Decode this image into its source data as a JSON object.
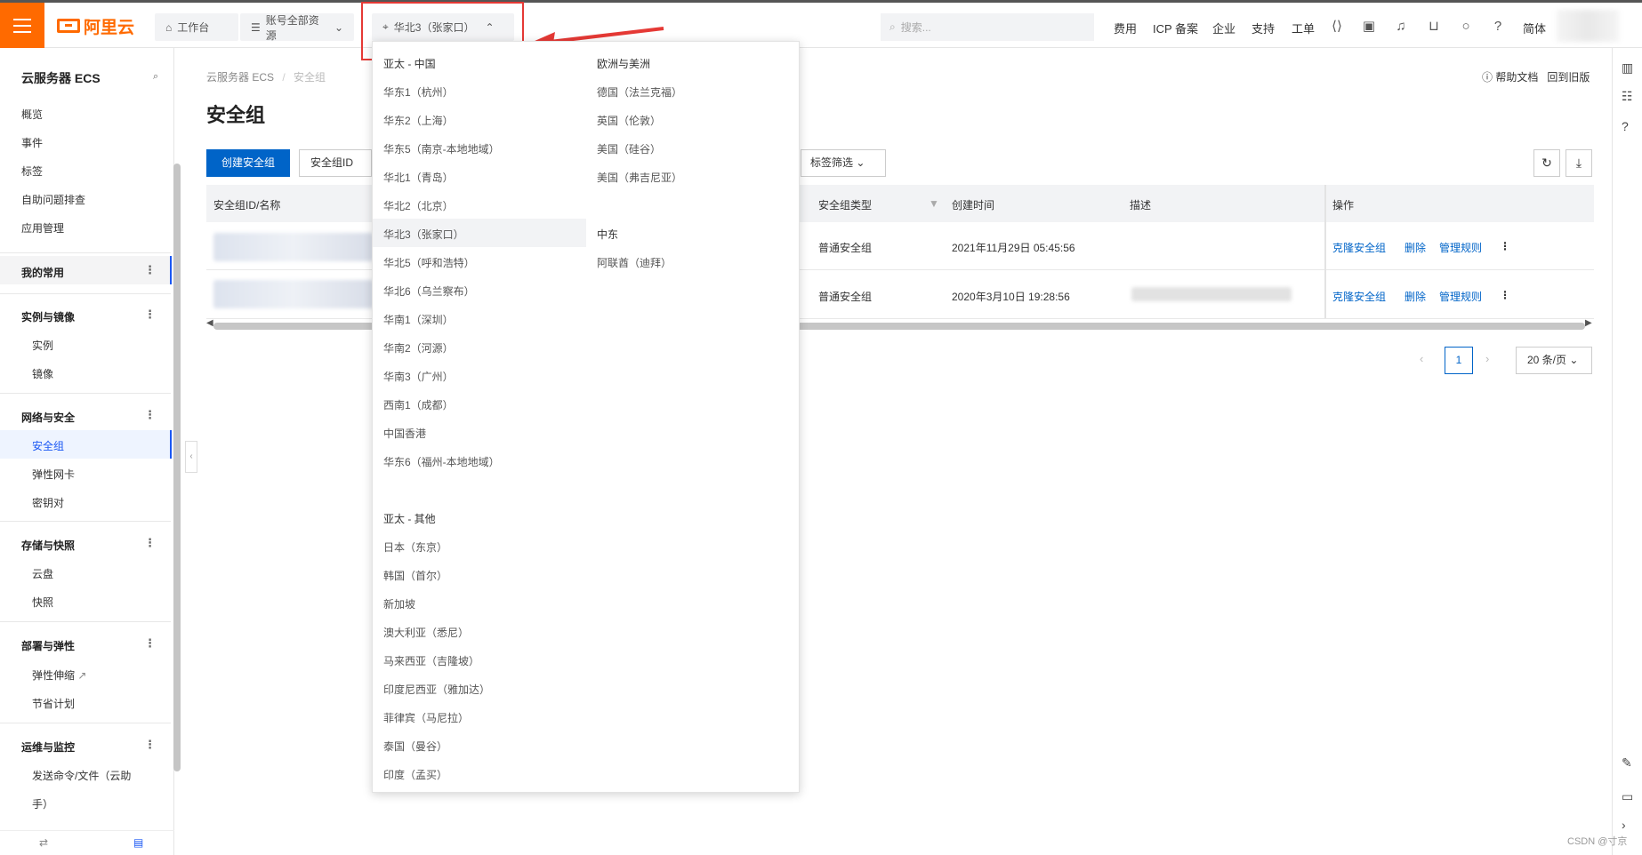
{
  "topbar": {
    "logo_text": "阿里云",
    "workbench": "工作台",
    "resources": "账号全部资源",
    "region": "华北3（张家口）",
    "search_placeholder": "搜索...",
    "nav": [
      "费用",
      "ICP 备案",
      "企业",
      "支持",
      "工单"
    ],
    "lang": "简体",
    "accent_color": "#ff6a00",
    "highlight_color": "#e53935"
  },
  "sidebar": {
    "title": "云服务器 ECS",
    "top_items": [
      "概览",
      "事件",
      "标签",
      "自助问题排查",
      "应用管理"
    ],
    "favorites": "我的常用",
    "groups": [
      {
        "label": "实例与镜像",
        "items": [
          "实例",
          "镜像"
        ]
      },
      {
        "label": "网络与安全",
        "items": [
          "安全组",
          "弹性网卡",
          "密钥对"
        ]
      },
      {
        "label": "存储与快照",
        "items": [
          "云盘",
          "快照"
        ]
      },
      {
        "label": "部署与弹性",
        "items": [
          "弹性伸缩",
          "节省计划"
        ]
      },
      {
        "label": "运维与监控",
        "items": [
          "发送命令/文件（云助",
          "手）"
        ]
      }
    ],
    "active_item": "安全组"
  },
  "main": {
    "breadcrumb": [
      "云服务器 ECS",
      "/",
      "安全组"
    ],
    "title": "安全组",
    "help_doc": "帮助文档",
    "old_version": "回到旧版",
    "create_button": "创建安全组",
    "filter_select": "安全组ID",
    "tag_filter": "标签筛选",
    "columns": [
      "安全组ID/名称",
      "安全组类型",
      "创建时间",
      "描述",
      "操作"
    ],
    "rows": [
      {
        "type": "普通安全组",
        "created": "2021年11月29日 05:45:56",
        "ops": [
          "克隆安全组",
          "删除",
          "管理规则"
        ]
      },
      {
        "type": "普通安全组",
        "created": "2020年3月10日 19:28:56",
        "ops": [
          "克隆安全组",
          "删除",
          "管理规则"
        ]
      }
    ],
    "pager": {
      "current": "1",
      "page_size": "20 条/页"
    }
  },
  "region_dropdown": {
    "col1_head": "亚太 - 中国",
    "col1": [
      "华东1（杭州）",
      "华东2（上海）",
      "华东5（南京-本地地域）",
      "华北1（青岛）",
      "华北2（北京）",
      "华北3（张家口）",
      "华北5（呼和浩特）",
      "华北6（乌兰察布）",
      "华南1（深圳）",
      "华南2（河源）",
      "华南3（广州）",
      "西南1（成都）",
      "中国香港",
      "华东6（福州-本地地域）"
    ],
    "col1b_head": "亚太 - 其他",
    "col1b": [
      "日本（东京）",
      "韩国（首尔）",
      "新加坡",
      "澳大利亚（悉尼）",
      "马来西亚（吉隆坡）",
      "印度尼西亚（雅加达）",
      "菲律宾（马尼拉）",
      "泰国（曼谷）",
      "印度（孟买）"
    ],
    "col2_head": "欧洲与美洲",
    "col2": [
      "德国（法兰克福）",
      "英国（伦敦）",
      "美国（硅谷）",
      "美国（弗吉尼亚）"
    ],
    "col2b_head": "中东",
    "col2b": [
      "阿联酋（迪拜）"
    ],
    "selected": "华北3（张家口）"
  },
  "watermark": "CSDN @寸京"
}
